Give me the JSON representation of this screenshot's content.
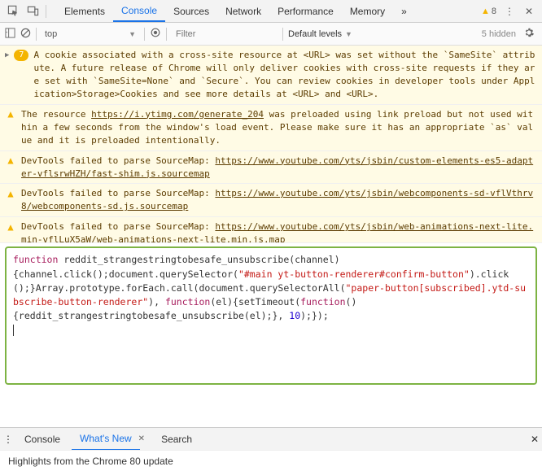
{
  "tabs": {
    "items": [
      "Elements",
      "Console",
      "Sources",
      "Network",
      "Performance",
      "Memory"
    ],
    "activeIndex": 1,
    "warningCount": "8"
  },
  "toolbar": {
    "context": "top",
    "filterPlaceholder": "Filter",
    "levels": "Default levels",
    "hidden": "5 hidden"
  },
  "messages": [
    {
      "type": "warn-group",
      "count": "7",
      "text": "A cookie associated with a cross-site resource at <URL> was set without the `SameSite` attribute. A future release of Chrome will only deliver cookies with cross-site requests if they are set with `SameSite=None` and `Secure`. You can review cookies in developer tools under Application>Storage>Cookies and see more details at <URL> and <URL>."
    },
    {
      "type": "warn",
      "pre": "The resource ",
      "link": "https://i.ytimg.com/generate_204",
      "post": " was preloaded using link preload but not used within a few seconds from the window's load event. Please make sure it has an appropriate `as` value and it is preloaded intentionally."
    },
    {
      "type": "warn",
      "pre": "DevTools failed to parse SourceMap: ",
      "link": "https://www.youtube.com/yts/jsbin/custom-elements-es5-adapter-vflsrwHZH/fast-shim.js.sourcemap",
      "post": ""
    },
    {
      "type": "warn",
      "pre": "DevTools failed to parse SourceMap: ",
      "link": "https://www.youtube.com/yts/jsbin/webcomponents-sd-vflVthrv8/webcomponents-sd.js.sourcemap",
      "post": ""
    },
    {
      "type": "warn",
      "pre": "DevTools failed to parse SourceMap: ",
      "link": "https://www.youtube.com/yts/jsbin/web-animations-next-lite.min-vflLuX5aW/web-animations-next-lite.min.js.map",
      "post": ""
    }
  ],
  "codeInput": {
    "tokens": [
      {
        "t": "kw",
        "v": "function"
      },
      {
        "t": "",
        "v": " reddit_strangestringtobesafe_unsubscribe(channel)\n{channel.click();document.querySelector("
      },
      {
        "t": "str",
        "v": "\"#main yt-button-renderer#confirm-button\""
      },
      {
        "t": "",
        "v": ").click();}Array.prototype.forEach.call(document.querySelectorAll("
      },
      {
        "t": "str",
        "v": "\"paper-button[subscribed].ytd-subscribe-button-renderer\""
      },
      {
        "t": "",
        "v": "), "
      },
      {
        "t": "kw",
        "v": "function"
      },
      {
        "t": "",
        "v": "(el){setTimeout("
      },
      {
        "t": "kw",
        "v": "function"
      },
      {
        "t": "",
        "v": "()\n{reddit_strangestringtobesafe_unsubscribe(el);}, "
      },
      {
        "t": "num",
        "v": "10"
      },
      {
        "t": "",
        "v": ");});"
      }
    ]
  },
  "drawer": {
    "tabs": [
      "Console",
      "What's New",
      "Search"
    ],
    "activeIndex": 1,
    "closable": [
      false,
      true,
      false
    ],
    "content": "Highlights from the Chrome 80 update"
  }
}
